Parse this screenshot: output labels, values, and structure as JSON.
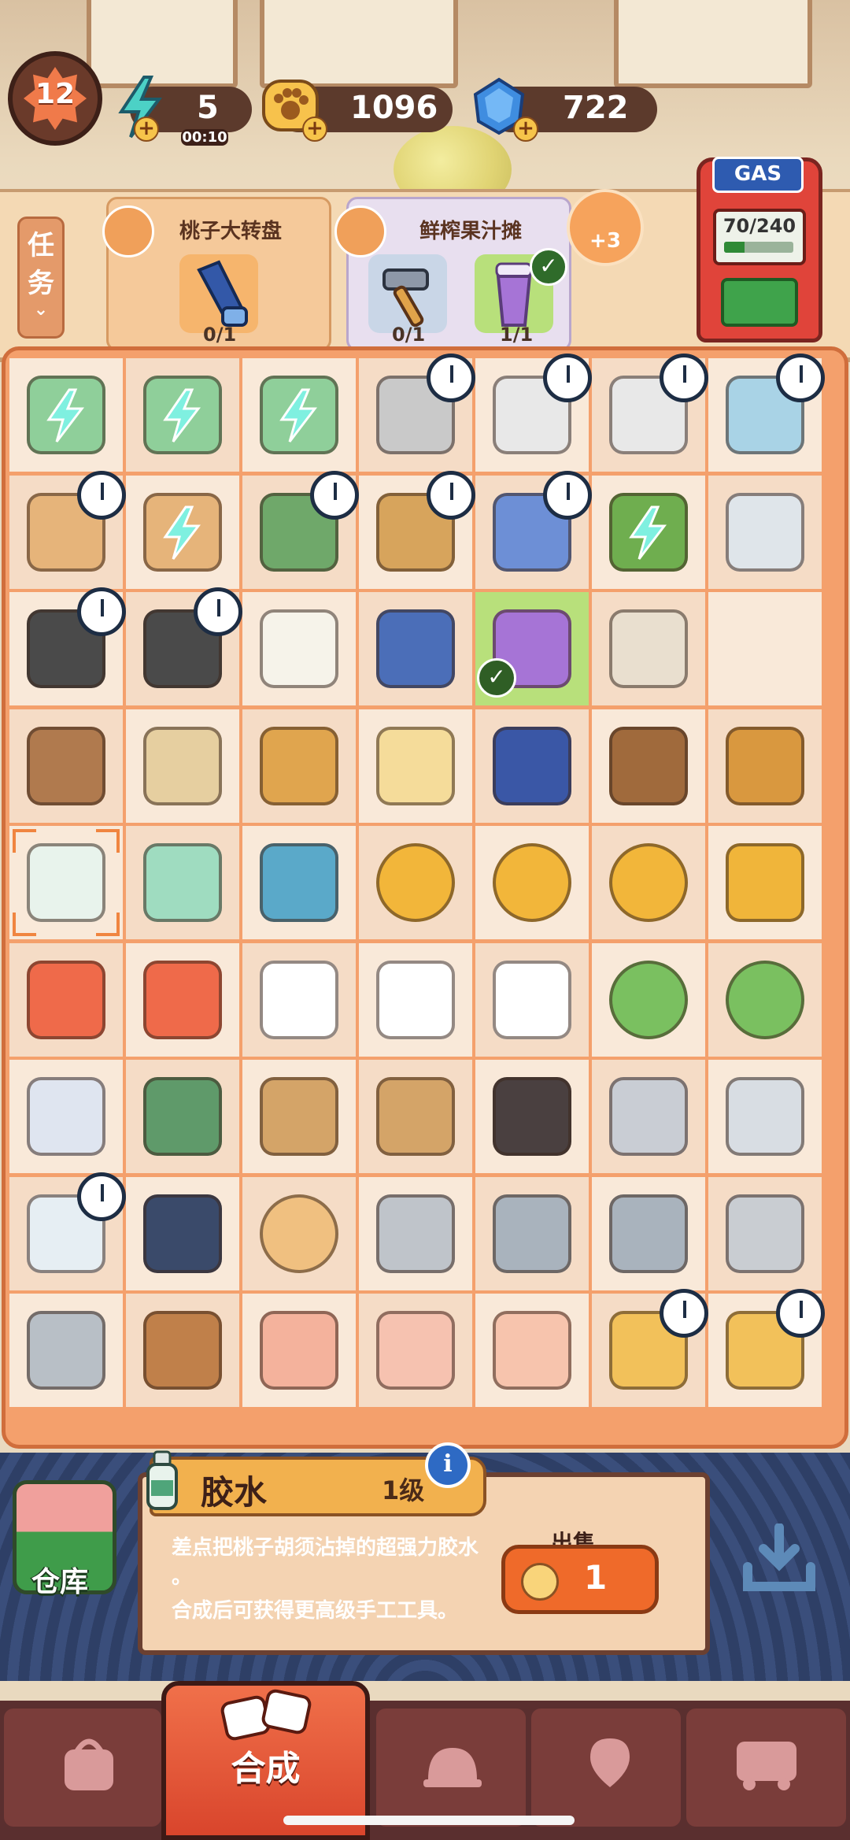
{
  "top_bar": {
    "level": "12",
    "energy": {
      "value": "5",
      "timer": "00:10",
      "icon": "lightning-energy-icon"
    },
    "coins": {
      "value": "1096",
      "icon": "paw-coin-icon"
    },
    "gems": {
      "value": "722",
      "icon": "blue-gem-icon"
    }
  },
  "tasks": {
    "tab_label": "任务",
    "orders": [
      {
        "title": "桃子大转盘",
        "progress": "0/1",
        "item": "telescope-icon"
      },
      {
        "title": "鲜榨果汁摊",
        "progress_a": "0/1",
        "progress_b": "1/1",
        "item_a": "hammer-icon",
        "item_b": "juice-cup-icon"
      }
    ],
    "bonus": "+3"
  },
  "gas_pump": {
    "label": "GAS",
    "fuel": "70/240",
    "fill": 0.29
  },
  "board": {
    "rows": [
      [
        "pot-stew",
        "pot-stew",
        "pot-stew",
        "toaster",
        "printer",
        "printer",
        "cabinet"
      ],
      [
        "shelf-bottles",
        "shelf-bottles",
        "bicycle-crate",
        "hand-truck-boxes",
        "notepad",
        "plant-branch",
        "glass-cloth"
      ],
      [
        "fabric-rolls",
        "fabric-rolls",
        "sugar-cubes",
        "calendar",
        "juice-cup",
        "coffee-bag",
        "empty"
      ],
      [
        "tray-seeds",
        "tray-rice",
        "socket-box",
        "cheese-block",
        "fountain-pen",
        "rope-coil",
        "mallet"
      ],
      [
        "glue-bottle",
        "ruler",
        "tin-can",
        "paw-coin",
        "paw-coins",
        "paw-coin-pile",
        "gold-bars"
      ],
      [
        "red-triangle",
        "orange-star",
        "chef-hat-small",
        "chef-hat",
        "chef-hat-tall",
        "green-seed",
        "green-sprout"
      ],
      [
        "paper-stack",
        "hand-truck",
        "wood-brackets",
        "wood-brackets-set",
        "wood-shelf",
        "metal-plates",
        "metal-sheets"
      ],
      [
        "ink-bottle",
        "ink-bottle-dark",
        "porridge-bowl",
        "silver-ingot",
        "small-kunai",
        "kunai",
        "gear"
      ],
      [
        "spinning-top",
        "wooden-top",
        "pink-paper",
        "envelope",
        "folded-paper",
        "gift-box",
        "gift-box"
      ]
    ]
  },
  "selected_item": {
    "name": "胶水",
    "level": "1级",
    "desc_line1": "差点把桃子胡须沾掉的超强力胶水",
    "desc_line2": "。",
    "desc_line3": "合成后可获得更高级手工工具。",
    "sell_label": "出售",
    "sell_price": "1"
  },
  "storage_label": "仓库",
  "nav": {
    "active_label": "合成",
    "tabs": [
      "shopping-bag-icon",
      "merge-icon",
      "service-bell-icon",
      "map-pin-icon",
      "bus-icon"
    ]
  }
}
